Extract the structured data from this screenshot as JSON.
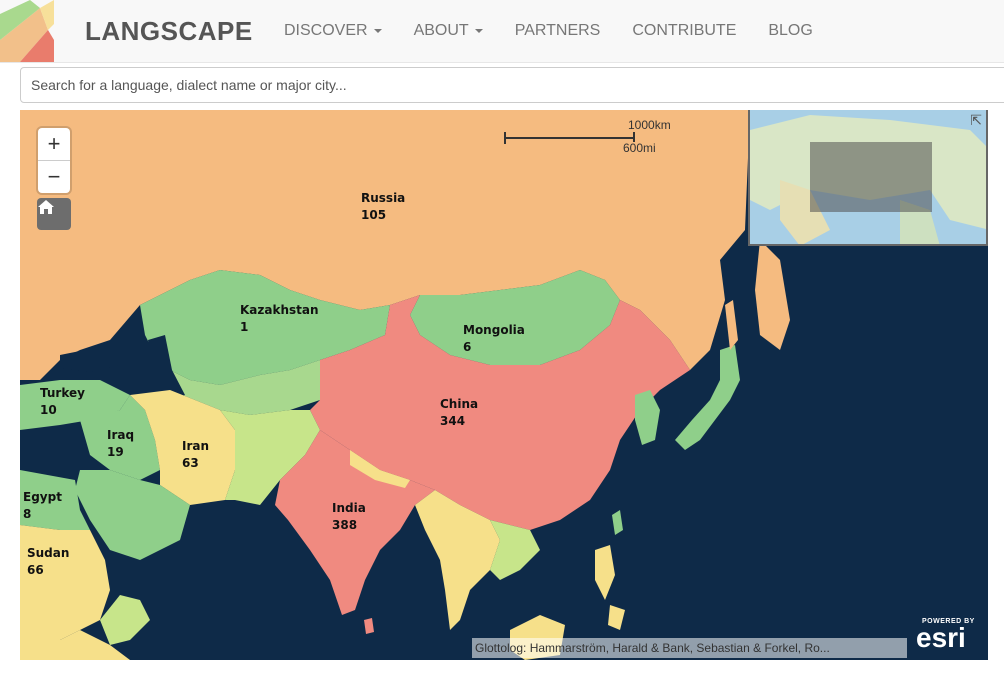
{
  "header": {
    "brand": "LANGSCAPE",
    "nav": [
      {
        "label": "DISCOVER",
        "dropdown": true
      },
      {
        "label": "ABOUT",
        "dropdown": true
      },
      {
        "label": "PARTNERS",
        "dropdown": false
      },
      {
        "label": "CONTRIBUTE",
        "dropdown": false
      },
      {
        "label": "BLOG",
        "dropdown": false
      }
    ]
  },
  "search": {
    "placeholder": "Search for a language, dialect name or major city..."
  },
  "map": {
    "zoom_in": "+",
    "zoom_out": "−",
    "home_icon": "home-icon",
    "scale": {
      "km": "1000km",
      "mi": "600mi"
    },
    "countries": [
      {
        "name": "Russia",
        "count": "105"
      },
      {
        "name": "Kazakhstan",
        "count": "1"
      },
      {
        "name": "Mongolia",
        "count": "6"
      },
      {
        "name": "Turkey",
        "count": "10"
      },
      {
        "name": "Iraq",
        "count": "19"
      },
      {
        "name": "Iran",
        "count": "63"
      },
      {
        "name": "China",
        "count": "344"
      },
      {
        "name": "Egypt",
        "count": "8"
      },
      {
        "name": "India",
        "count": "388"
      },
      {
        "name": "Sudan",
        "count": "66"
      }
    ],
    "attribution": "Glottolog: Hammarström, Harald & Bank, Sebastian & Forkel, Ro...",
    "esri": {
      "powered_by": "POWERED BY",
      "logo": "esri"
    },
    "colors": {
      "ocean": "#0e2a48",
      "russia": "#f5bb80",
      "china_india": "#f08a80",
      "green": "#8fcf8a",
      "yellow": "#f6e08a",
      "light_green": "#c7e58a"
    }
  }
}
